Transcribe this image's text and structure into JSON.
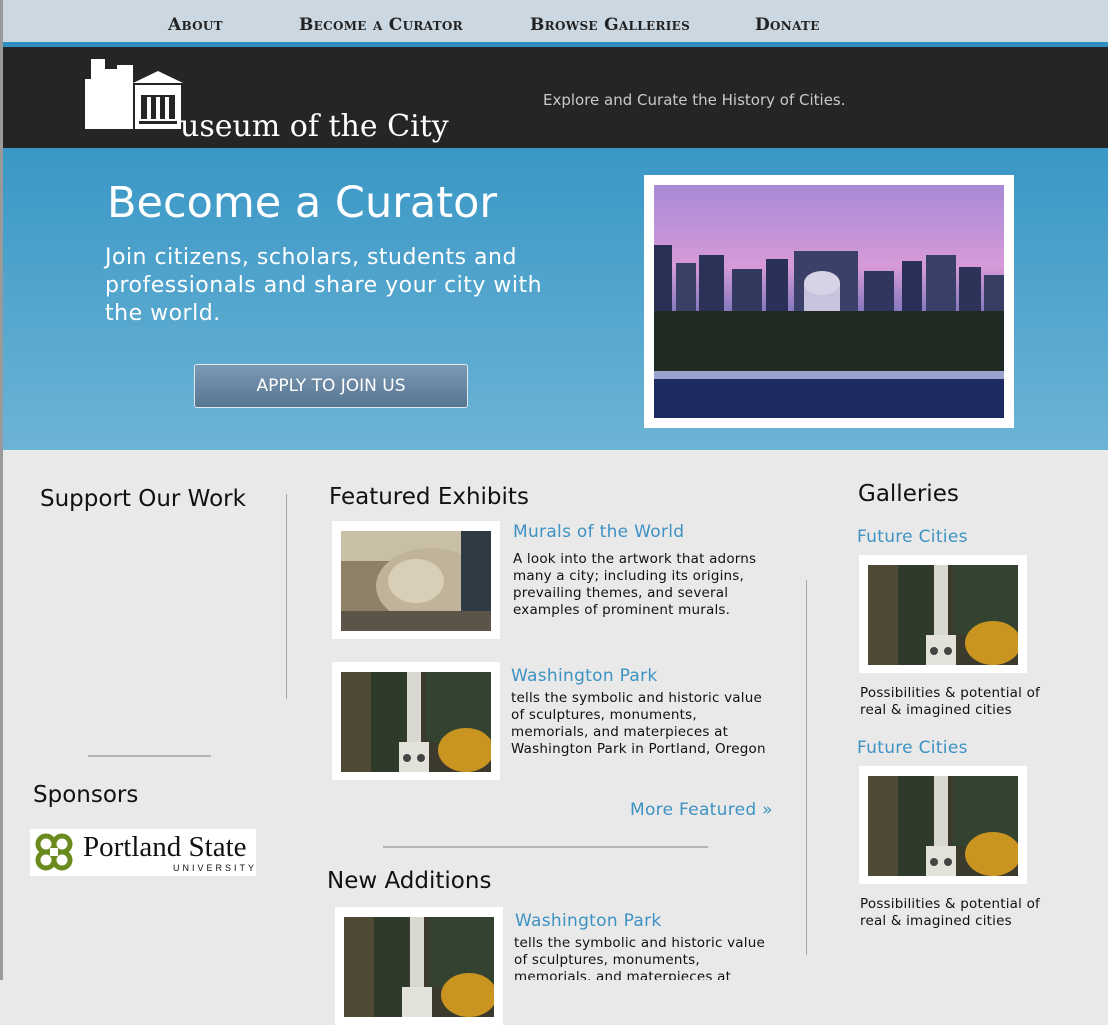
{
  "nav": {
    "items": [
      {
        "label": "About"
      },
      {
        "label": "Become a Curator"
      },
      {
        "label": "Browse Galleries"
      },
      {
        "label": "Donate"
      }
    ]
  },
  "header": {
    "logo_text": "useum of the City",
    "tagline": "Explore and Curate the History of Cities."
  },
  "hero": {
    "title": "Become a Curator",
    "subtitle": "Join citizens, scholars, students and professionals and share your city with the world.",
    "button_label": "APPLY TO JOIN US"
  },
  "support": {
    "heading": "Support Our Work"
  },
  "sponsors": {
    "heading": "Sponsors",
    "logo_name": "Portland State",
    "logo_sub": "UNIVERSITY"
  },
  "featured": {
    "heading": "Featured Exhibits",
    "items": [
      {
        "title": "Murals of the World",
        "description": "A look into the artwork that adorns many a city; including its origins, prevailing themes, and several examples of prominent murals.",
        "image": "mural-photo"
      },
      {
        "title": "Washington Park",
        "description": "tells the symbolic and historic value of sculptures, monuments, memorials, and materpieces at Washington Park in Portland, Oregon",
        "image": "monument-photo"
      }
    ],
    "more_link": "More Featured »"
  },
  "new_additions": {
    "heading": "New Additions",
    "items": [
      {
        "title": "Washington Park",
        "description": "tells the symbolic and historic value of sculptures, monuments, memorials, and materpieces at",
        "image": "monument-photo"
      }
    ]
  },
  "galleries": {
    "heading": "Galleries",
    "items": [
      {
        "title": "Future Cities",
        "description": "Possibilities & potential of real & imagined cities",
        "image": "monument-photo"
      },
      {
        "title": "Future Cities",
        "description": "Possibilities & potential of real & imagined cities",
        "image": "monument-photo"
      }
    ]
  },
  "colors": {
    "nav_bg": "#cbd8e2",
    "accent_blue": "#2e8fc0",
    "header_bg": "#252525",
    "link_blue": "#3d92c4",
    "content_bg": "#e9e9e9",
    "psu_green": "#6a8a1e"
  }
}
